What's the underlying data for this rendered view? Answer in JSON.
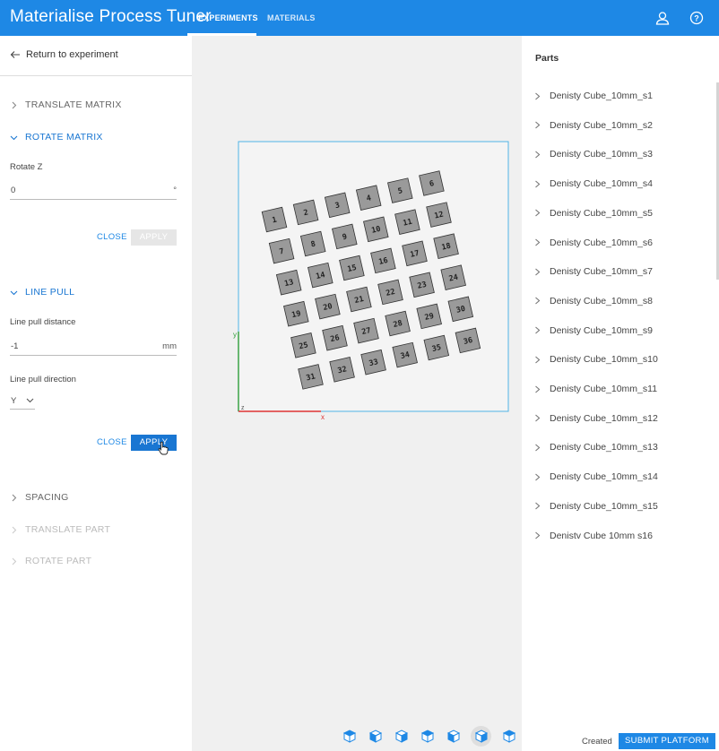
{
  "app": {
    "title": "Materialise Process Tuner",
    "nav": [
      {
        "label": "EXPERIMENTS",
        "active": true
      },
      {
        "label": "MATERIALS",
        "active": false
      }
    ],
    "user_icon": "user-icon",
    "help_icon": "help-icon",
    "accent": "#1e88e5"
  },
  "left": {
    "return_label": "Return to experiment",
    "sections": {
      "translate_matrix": "TRANSLATE MATRIX",
      "rotate_matrix": "ROTATE MATRIX",
      "line_pull": "LINE PULL",
      "spacing": "SPACING",
      "translate_part": "TRANSLATE PART",
      "rotate_part": "ROTATE PART"
    },
    "rotate": {
      "label": "Rotate Z",
      "value": "0",
      "unit": "°",
      "close": "CLOSE",
      "apply": "APPLY"
    },
    "line_pull": {
      "distance_label": "Line pull distance",
      "distance_value": "-1",
      "distance_unit": "mm",
      "direction_label": "Line pull direction",
      "direction_value": "Y",
      "close": "CLOSE",
      "apply": "APPLY"
    }
  },
  "viewport": {
    "axis_y": "y",
    "axis_x": "x",
    "axis_z": "z",
    "cubes": [
      "1",
      "2",
      "3",
      "4",
      "5",
      "6",
      "7",
      "8",
      "9",
      "10",
      "11",
      "12",
      "13",
      "14",
      "15",
      "16",
      "17",
      "18",
      "19",
      "20",
      "21",
      "22",
      "23",
      "24",
      "25",
      "26",
      "27",
      "28",
      "29",
      "30",
      "31",
      "32",
      "33",
      "34",
      "35",
      "36"
    ],
    "view_icons": [
      "view-iso-icon",
      "view-front-icon",
      "view-left-icon",
      "view-back-icon",
      "view-right-icon",
      "view-top-icon",
      "view-bottom-icon"
    ]
  },
  "right": {
    "title": "Parts",
    "parts": [
      "Denisty Cube_10mm_s1",
      "Denisty Cube_10mm_s2",
      "Denisty Cube_10mm_s3",
      "Denisty Cube_10mm_s4",
      "Denisty Cube_10mm_s5",
      "Denisty Cube_10mm_s6",
      "Denisty Cube_10mm_s7",
      "Denisty Cube_10mm_s8",
      "Denisty Cube_10mm_s9",
      "Denisty Cube_10mm_s10",
      "Denisty Cube_10mm_s11",
      "Denisty Cube_10mm_s12",
      "Denisty Cube_10mm_s13",
      "Denisty Cube_10mm_s14",
      "Denisty Cube_10mm_s15",
      "Denistv Cube 10mm s16"
    ],
    "created_label": "Created",
    "submit_label": "SUBMIT PLATFORM"
  }
}
